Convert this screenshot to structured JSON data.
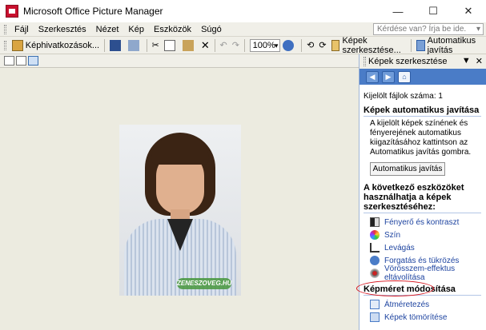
{
  "window": {
    "title": "Microsoft Office Picture Manager",
    "minimize": "—",
    "maximize": "☐",
    "close": "✕"
  },
  "menubar": {
    "items": [
      "Fájl",
      "Szerkesztés",
      "Nézet",
      "Kép",
      "Eszközök",
      "Súgó"
    ],
    "help_placeholder": "Kérdése van? Írja be ide."
  },
  "toolbar": {
    "shortcuts_label": "Képhivatkozások...",
    "zoom_value": "100%",
    "edit_label": "Képek szerkesztése...",
    "autofix_label": "Automatikus javítás"
  },
  "panel": {
    "title": "Képek szerkesztése",
    "selected_count": "Kijelölt fájlok száma: 1",
    "auto_section": "Képek automatikus javítása",
    "auto_desc": "A kijelölt képek színének és fényerejének automatikus kiigazításához kattintson az Automatikus javítás gombra.",
    "auto_button": "Automatikus javítás",
    "tools_section": "A következő eszközöket használhatja a képek szerkesztéséhez:",
    "tools": [
      "Fényerő és kontraszt",
      "Szín",
      "Levágás",
      "Forgatás és tükrözés",
      "Vörösszem-effektus eltávolítása"
    ],
    "resize_section": "Képméret módosítása",
    "resize_links": [
      "Átméretezés",
      "Képek tömörítése"
    ]
  },
  "photo": {
    "watermark": "ZENESZOVEG.HU"
  },
  "colors": {
    "accent": "#4a7cc7",
    "link": "#1e44a0",
    "highlight": "#d6101a"
  }
}
